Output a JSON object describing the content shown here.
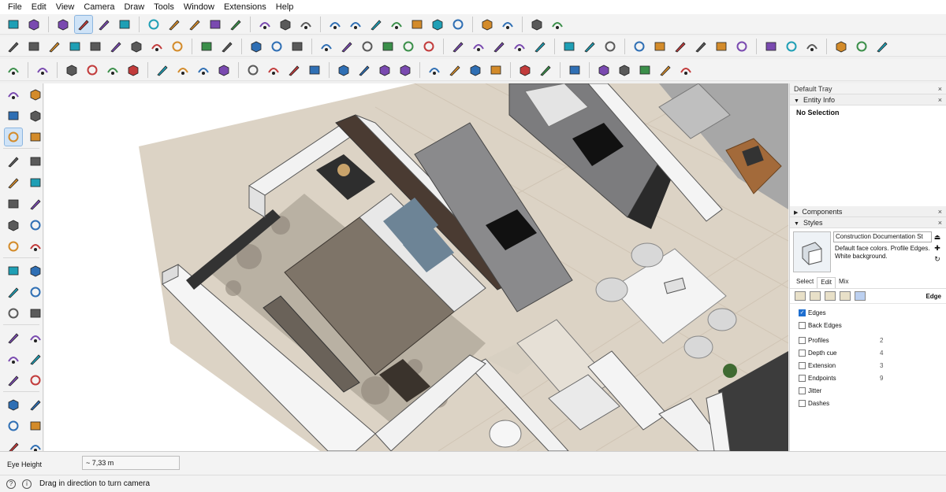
{
  "menu": [
    "File",
    "Edit",
    "View",
    "Camera",
    "Draw",
    "Tools",
    "Window",
    "Extensions",
    "Help"
  ],
  "toolbar_row1": [
    "get-models-icon",
    "share-model-icon",
    "cube-3d-icon",
    "box-view-icon",
    "layer-box-icon",
    "solid-box-icon",
    "house-home-icon",
    "front-view-icon",
    "right-view-icon",
    "back-view-icon",
    "left-view-icon",
    "bottom-view-icon",
    "solid-inspector-icon",
    "fix-faces-icon",
    "arc-arrow-icon",
    "push-pull-red-icon",
    "box-j-icon",
    "box-r-icon",
    "box-v-icon",
    "box-x-icon",
    "box-f-icon",
    "f6-icon",
    "hand-icon",
    "recycle-icon",
    "leaf-icon"
  ],
  "toolbar_row2": [
    "pencil-icon",
    "freehand-icon",
    "rectangle-icon",
    "rotated-rect-icon",
    "circle-icon",
    "polygon-icon",
    "arc-icon",
    "pie-icon",
    "three-point-arc-icon",
    "textured-box-icon",
    "grid-icon",
    "push-pull-icon",
    "follow-me-icon",
    "offset-icon",
    "solid-tools-icon",
    "intersect-icon",
    "union-icon",
    "subtract-icon",
    "trim-icon",
    "split-icon",
    "tape-icon",
    "protractor-icon",
    "axes-icon",
    "dimension-icon",
    "text-icon",
    "move-icon",
    "rotate-icon",
    "scale-icon",
    "zoom-icon",
    "zoom-window-icon",
    "zoom-extents-icon",
    "walk-icon",
    "look-around-icon",
    "footprints-icon",
    "section-plane-icon",
    "section-fill-icon",
    "target-icon",
    "section-cube-icon",
    "section-blue-icon",
    "section-display-icon"
  ],
  "toolbar_row3": [
    "zoom-tool-icon",
    "select-arrow-icon",
    "eraser-icon",
    "line-pencil-icon",
    "arc-tool-icon",
    "rect-tool-icon",
    "push-pull-tool-icon",
    "rotate-tool-icon",
    "move-tool-icon",
    "refresh-tool-icon",
    "offset-tool-icon",
    "tape-measure-icon",
    "text-label-icon",
    "paint-bucket-icon",
    "orbit-icon",
    "pan-icon",
    "zoom-search-icon",
    "zoom-extents-tool-icon",
    "sandbox-icon",
    "smoove-icon",
    "stamp-icon",
    "flip-icon",
    "user-icon",
    "curve-icon",
    "warning-triangle-icon",
    "sync-icon",
    "sync-alt-icon",
    "plug-icon",
    "export-icon",
    "document-icon"
  ],
  "left_tools": [
    [
      "select-arrow-icon",
      "orbit-lasso-icon"
    ],
    [
      "paint-bucket-icon",
      "eraser-icon"
    ],
    [
      "component-icon",
      "tag-icon"
    ],
    [
      "pencil-icon",
      "freehand-icon"
    ],
    [
      "rectangle-icon",
      "rotated-rect-icon"
    ],
    [
      "circle-icon",
      "polygon-icon"
    ],
    [
      "arc-icon",
      "pie-arc-icon"
    ],
    [
      "three-point-arc-icon",
      "pie-icon"
    ],
    [
      "move-icon",
      "push-pull-icon"
    ],
    [
      "rotate-icon",
      "follow-me-icon"
    ],
    [
      "scale-icon",
      "offset-icon"
    ],
    [
      "tape-icon",
      "dimension-icon"
    ],
    [
      "protractor-icon",
      "text-icon"
    ],
    [
      "axes-icon",
      "3d-text-icon"
    ],
    [
      "orbit-icon",
      "pan-icon"
    ],
    [
      "zoom-icon",
      "zoom-window-icon"
    ],
    [
      "zoom-extents-icon",
      "search-icon"
    ]
  ],
  "tray": {
    "title": "Default Tray",
    "close": "×",
    "entity_info": {
      "title": "Entity Info",
      "value": "No Selection"
    },
    "components": {
      "title": "Components"
    },
    "styles": {
      "title": "Styles",
      "name": "Construction Documentation St",
      "description": "Default face colors. Profile Edges. White background.",
      "tabs": [
        "Select",
        "Edit",
        "Mix"
      ],
      "active_tab": "Edit",
      "section_label": "Edge",
      "options": [
        {
          "label": "Edges",
          "checked": true,
          "value": ""
        },
        {
          "label": "Back Edges",
          "checked": false,
          "value": ""
        },
        {
          "label": "Profiles",
          "checked": false,
          "value": "2"
        },
        {
          "label": "Depth cue",
          "checked": false,
          "value": "4"
        },
        {
          "label": "Extension",
          "checked": false,
          "value": "3"
        },
        {
          "label": "Endpoints",
          "checked": false,
          "value": "9"
        },
        {
          "label": "Jitter",
          "checked": false,
          "value": ""
        },
        {
          "label": "Dashes",
          "checked": false,
          "value": ""
        }
      ]
    }
  },
  "measurement": {
    "label": "Eye Height",
    "value": "~ 7,33 m"
  },
  "status": {
    "text": "Drag in direction to turn camera"
  },
  "colors": {
    "accent": "#1e6fd0",
    "floor": "#d9cfc0",
    "wall": "#f2f2f2",
    "dark_wall": "#3a3a3a"
  }
}
